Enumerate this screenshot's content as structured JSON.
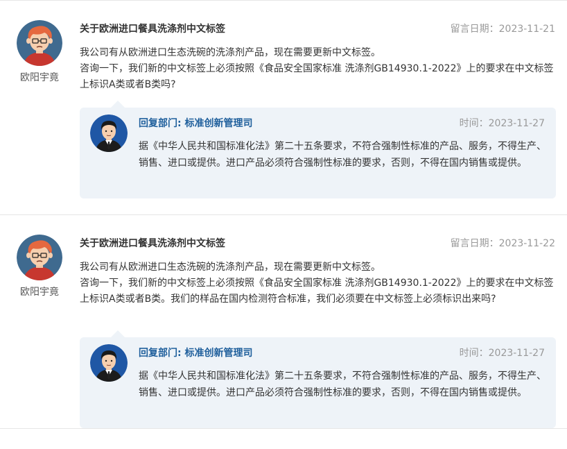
{
  "messages": [
    {
      "user": "欧阳宇竟",
      "title": "关于欧洲进口餐具洗涤剂中文标签",
      "date_label": "留言日期：",
      "date": "2023-11-21",
      "lines": [
        "我公司有从欧洲进口生态洗碗的洗涤剂产品，现在需要更新中文标签。",
        "咨询一下，我们新的中文标签上必须按照《食品安全国家标准 洗涤剂GB14930.1-2022》上的要求在中文标签上标识A类或者B类吗?"
      ],
      "reply": {
        "dept_label": "回复部门: ",
        "dept": "标准创新管理司",
        "time_label": "时间：",
        "time": "2023-11-27",
        "content": "据《中华人民共和国标准化法》第二十五条要求，不符合强制性标准的产品、服务，不得生产、销售、进口或提供。进口产品必须符合强制性标准的要求，否则，不得在国内销售或提供。"
      }
    },
    {
      "user": "欧阳宇竟",
      "title": "关于欧洲进口餐具洗涤剂中文标签",
      "date_label": "留言日期：",
      "date": "2023-11-22",
      "lines": [
        "我公司有从欧洲进口生态洗碗的洗涤剂产品，现在需要更新中文标签。",
        "咨询一下，我们新的中文标签上必须按照《食品安全国家标准 洗涤剂GB14930.1-2022》上的要求在中文标签上标识A类或者B类。我们的样品在国内检测符合标准，我们必须要在中文标签上必须标识出来吗?"
      ],
      "reply": {
        "dept_label": "回复部门: ",
        "dept": "标准创新管理司",
        "time_label": "时间：",
        "time": "2023-11-27",
        "content": "据《中华人民共和国标准化法》第二十五条要求，不符合强制性标准的产品、服务，不得生产、销售、进口或提供。进口产品必须符合强制性标准的要求，否则，不得在国内销售或提供。"
      }
    }
  ]
}
